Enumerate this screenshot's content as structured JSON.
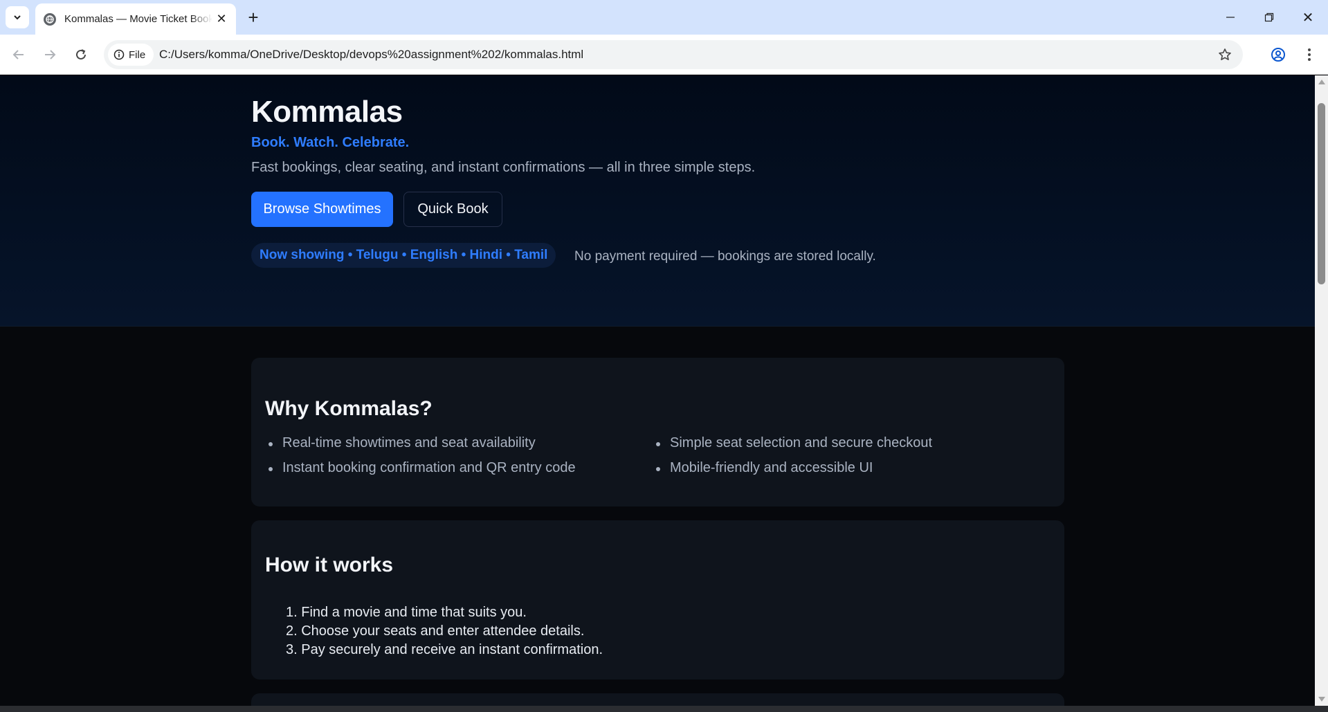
{
  "browser": {
    "tab_title": "Kommalas — Movie Ticket Booking",
    "site_chip": "File",
    "url": "C:/Users/komma/OneDrive/Desktop/devops%20assignment%202/kommalas.html"
  },
  "hero": {
    "brand": "Kommalas",
    "tagline": "Book. Watch. Celebrate.",
    "lead": "Fast bookings, clear seating, and instant confirmations — all in three simple steps.",
    "primary_button": "Browse Showtimes",
    "secondary_button": "Quick Book",
    "now_showing": "Now showing • Telugu • English • Hindi • Tamil",
    "note": "No payment required — bookings are stored locally."
  },
  "why": {
    "title": "Why Kommalas?",
    "items": [
      "Real-time showtimes and seat availability",
      "Simple seat selection and secure checkout",
      "Instant booking confirmation and QR entry code",
      "Mobile-friendly and accessible UI"
    ]
  },
  "how": {
    "title": "How it works",
    "steps": [
      "1. Find a movie and time that suits you.",
      "2. Choose your seats and enter attendee details.",
      "3. Pay securely and receive an instant confirmation."
    ]
  },
  "colors": {
    "accent": "#2472ff",
    "hero_bg": "#020a18",
    "card_bg": "#0f141c",
    "text_muted": "#aab3c2"
  },
  "icons": {
    "tab_search": "chevron-down-icon",
    "favicon": "globe-icon",
    "close": "close-icon",
    "new_tab": "plus-icon",
    "back": "arrow-left-icon",
    "forward": "arrow-right-icon",
    "reload": "reload-icon",
    "info": "info-icon",
    "bookmark": "star-icon",
    "profile": "profile-icon",
    "menu": "kebab-menu-icon"
  }
}
